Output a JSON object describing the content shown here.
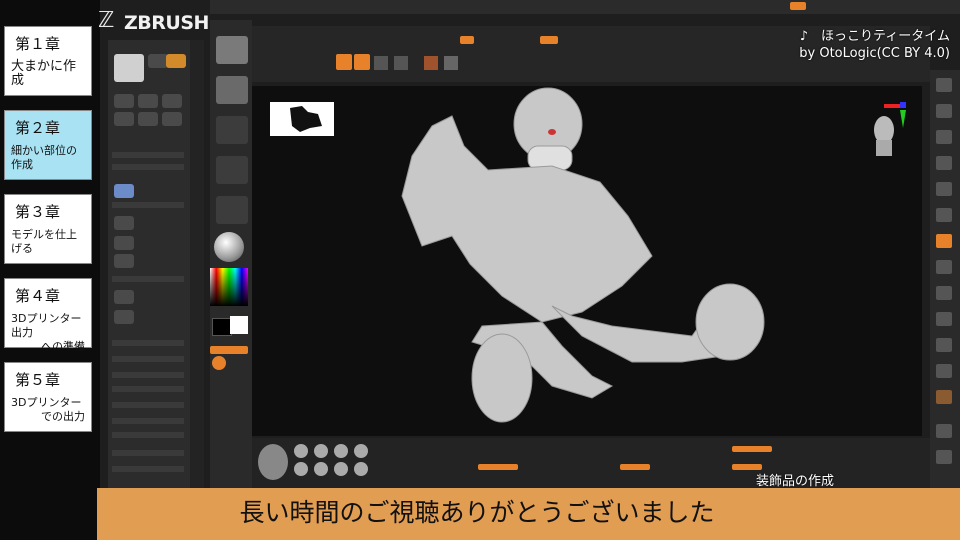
{
  "app": {
    "logo_text": "ZBRUSH"
  },
  "chapters": [
    {
      "num": "第１章",
      "lines": [
        "大まかに作成"
      ],
      "active": false
    },
    {
      "num": "第２章",
      "lines": [
        "細かい部位の作成"
      ],
      "active": true
    },
    {
      "num": "第３章",
      "lines": [
        "モデルを仕上げる"
      ],
      "active": false
    },
    {
      "num": "第４章",
      "lines": [
        "3Dプリンター出力",
        "への準備"
      ],
      "active": false
    },
    {
      "num": "第５章",
      "lines": [
        "3Dプリンター",
        "での出力"
      ],
      "active": false
    }
  ],
  "music_credit": {
    "title": "♪　ほっこりティータイム",
    "by": "by OtoLogic(CC BY 4.0)"
  },
  "caption": "装飾品の作成",
  "subtitle": "長い時間のご視聴ありがとうございました",
  "colors": {
    "accent": "#e8822a",
    "subtitle_bar": "#e19d52",
    "active_chapter": "#a9e3f3"
  }
}
